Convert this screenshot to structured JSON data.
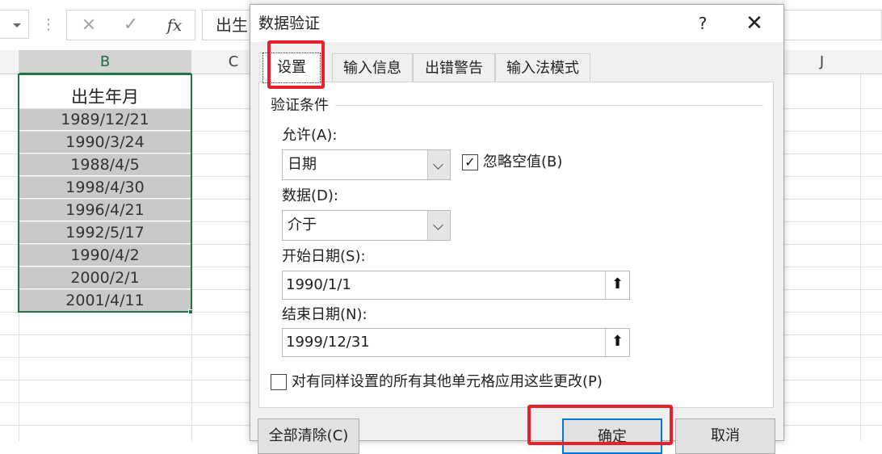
{
  "formula_bar": {
    "name_box_value": "",
    "dots": "⋮",
    "cancel_icon": "×",
    "enter_icon": "✓",
    "fx_label": "fx",
    "formula_text": "出生"
  },
  "sheet": {
    "columns": [
      "B",
      "C",
      "J"
    ],
    "header_cell": "出生年月",
    "dates": [
      "1989/12/21",
      "1990/3/24",
      "1988/4/5",
      "1998/4/30",
      "1996/4/21",
      "1992/5/17",
      "1990/4/2",
      "2000/2/1",
      "2001/4/11"
    ],
    "col_a_fragments": [
      "",
      "",
      "",
      "",
      "",
      "",
      "",
      "",
      "",
      ""
    ]
  },
  "dialog": {
    "title": "数据验证",
    "help": "?",
    "close": "✕",
    "tabs": [
      "设置",
      "输入信息",
      "出错警告",
      "输入法模式"
    ],
    "active_tab": "设置",
    "group_label": "验证条件",
    "allow_label": "允许(A):",
    "allow_value": "日期",
    "ignore_blank_label": "忽略空值(B)",
    "ignore_blank_checked": true,
    "data_label": "数据(D):",
    "data_value": "介于",
    "start_label": "开始日期(S):",
    "start_value": "1990/1/1",
    "end_label": "结束日期(N):",
    "end_value": "1999/12/31",
    "apply_all_label": "对有同样设置的所有其他单元格应用这些更改(P)",
    "apply_all_checked": false,
    "clear_all_button": "全部清除(C)",
    "ok_button": "确定",
    "cancel_button": "取消",
    "checkmark": "✓",
    "ref_arrow": "⬆"
  },
  "colors": {
    "excel_green": "#217346",
    "highlight_red": "#e8202a",
    "selected_fill": "#c9c9c9"
  }
}
